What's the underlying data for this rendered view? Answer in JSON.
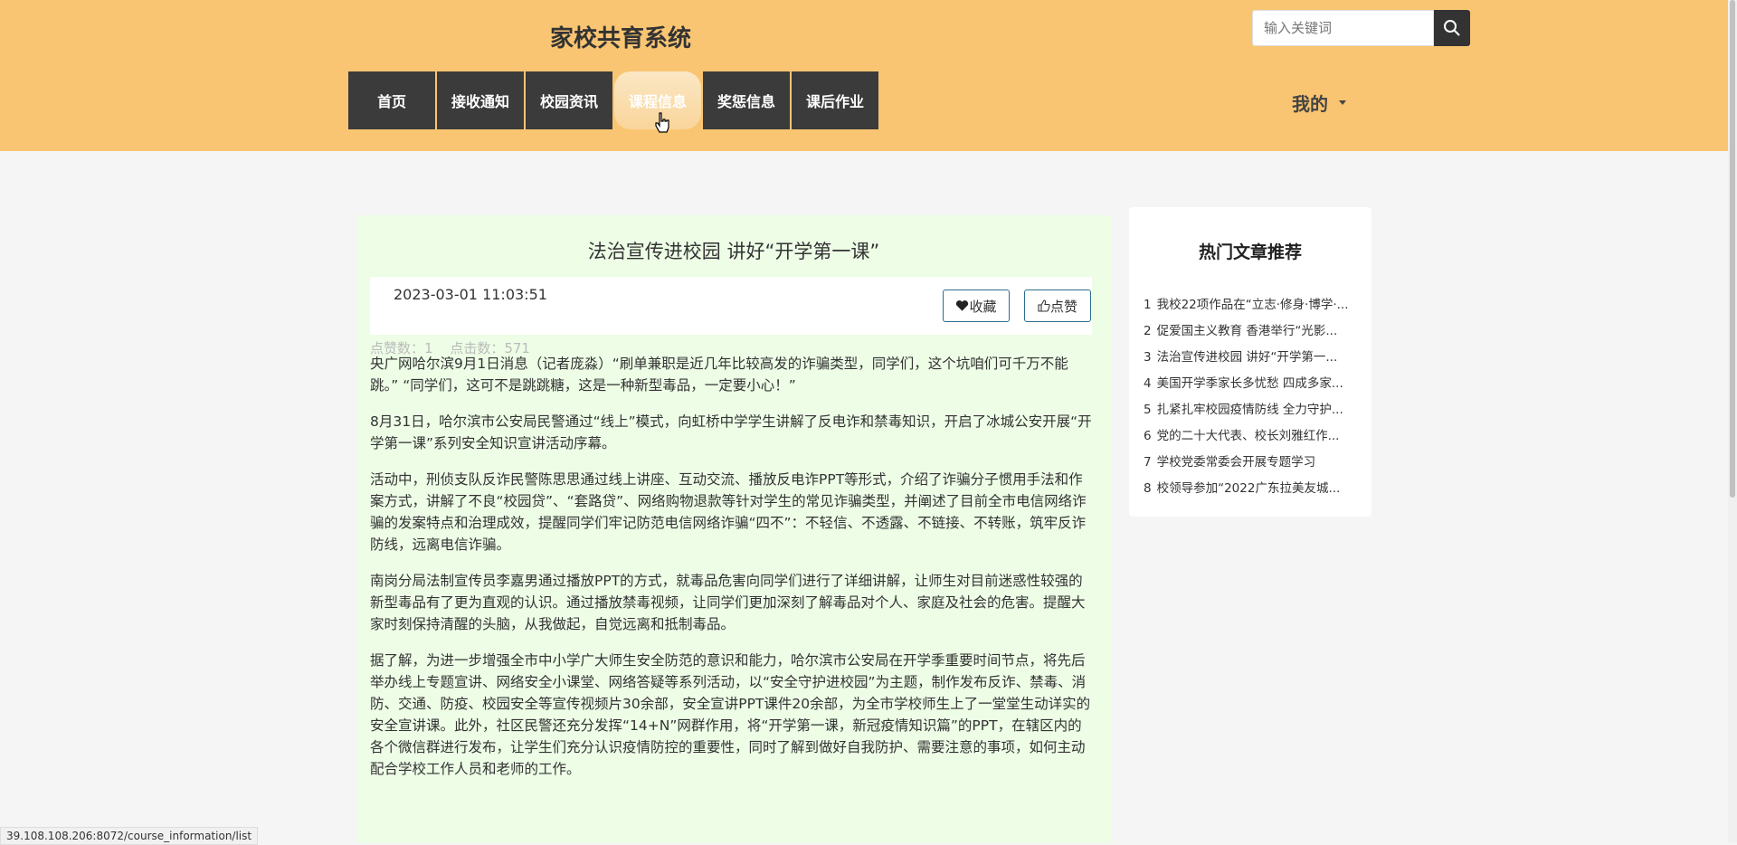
{
  "header": {
    "site_title": "家校共育系统",
    "search": {
      "placeholder": "输入关键词"
    },
    "nav": [
      {
        "label": "首页"
      },
      {
        "label": "接收通知"
      },
      {
        "label": "校园资讯"
      },
      {
        "label": "课程信息",
        "active": true
      },
      {
        "label": "奖惩信息"
      },
      {
        "label": "课后作业"
      }
    ],
    "user_menu": "我的"
  },
  "article": {
    "title": "法治宣传进校园 讲好“开学第一课”",
    "date": "2023-03-01 11:03:51",
    "likes": "点赞数：1",
    "clicks": "点击数：571",
    "favorite_label": "收藏",
    "like_label": "点赞",
    "paragraphs": [
      "央广网哈尔滨9月1日消息（记者庞淼）“刷单兼职是近几年比较高发的诈骗类型，同学们，这个坑咱们可千万不能跳。” “同学们，这可不是跳跳糖，这是一种新型毒品，一定要小心！”",
      "8月31日，哈尔滨市公安局民警通过“线上”模式，向虹桥中学学生讲解了反电诈和禁毒知识，开启了冰城公安开展“开学第一课”系列安全知识宣讲活动序幕。",
      "活动中，刑侦支队反诈民警陈思思通过线上讲座、互动交流、播放反电诈PPT等形式，介绍了诈骗分子惯用手法和作案方式，讲解了不良“校园贷”、“套路贷”、网络购物退款等针对学生的常见诈骗类型，并阐述了目前全市电信网络诈骗的发案特点和治理成效，提醒同学们牢记防范电信网络诈骗“四不”：不轻信、不透露、不链接、不转账，筑牢反诈防线，远离电信诈骗。",
      "南岗分局法制宣传员李嘉男通过播放PPT的方式，就毒品危害向同学们进行了详细讲解，让师生对目前迷惑性较强的新型毒品有了更为直观的认识。通过播放禁毒视频，让同学们更加深刻了解毒品对个人、家庭及社会的危害。提醒大家时刻保持清醒的头脑，从我做起，自觉远离和抵制毒品。",
      "据了解，为进一步增强全市中小学广大师生安全防范的意识和能力，哈尔滨市公安局在开学季重要时间节点，将先后举办线上专题宣讲、网络安全小课堂、网络答疑等系列活动，以“安全守护进校园”为主题，制作发布反诈、禁毒、消防、交通、防疫、校园安全等宣传视频片30余部，安全宣讲PPT课件20余部，为全市学校师生上了一堂堂生动详实的安全宣讲课。此外，社区民警还充分发挥“14+N”网群作用，将“开学第一课，新冠疫情知识篇”的PPT，在辖区内的各个微信群进行发布，让学生们充分认识疫情防控的重要性，同时了解到做好自我防护、需要注意的事项，如何主动配合学校工作人员和老师的工作。"
    ]
  },
  "hot_articles": {
    "title": "热门文章推荐",
    "items": [
      {
        "num": "1",
        "text": "我校22项作品在“立志·修身·博学·..."
      },
      {
        "num": "2",
        "text": "促爱国主义教育 香港举行“光影..."
      },
      {
        "num": "3",
        "text": "法治宣传进校园 讲好“开学第一..."
      },
      {
        "num": "4",
        "text": "美国开学季家长多忧愁 四成多家..."
      },
      {
        "num": "5",
        "text": "扎紧扎牢校园疫情防线 全力守护..."
      },
      {
        "num": "6",
        "text": "党的二十大代表、校长刘雅红作..."
      },
      {
        "num": "7",
        "text": "学校党委常委会开展专题学习"
      },
      {
        "num": "8",
        "text": "校领导参加“2022广东拉美友城..."
      }
    ]
  },
  "status_bar": {
    "url": "39.108.108.206:8072/course_information/list"
  },
  "colors": {
    "header_bg": "#f9c572",
    "nav_bg": "#3b3b3b",
    "article_bg": "#edfde6",
    "accent": "#2d6e8e"
  }
}
